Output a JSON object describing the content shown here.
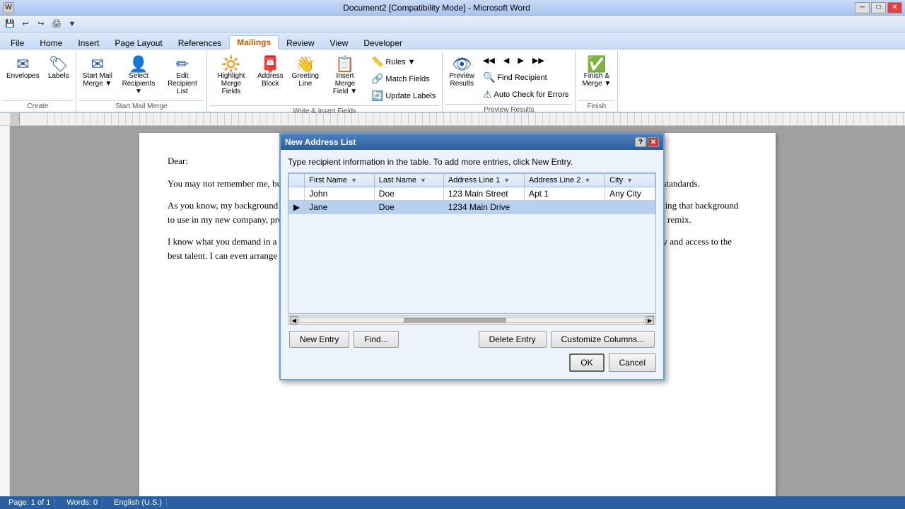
{
  "titlebar": {
    "title": "Document2 [Compatibility Mode] - Microsoft Word",
    "min": "─",
    "restore": "□",
    "close": "✕"
  },
  "quicktoolbar": {
    "buttons": [
      "💾",
      "↩",
      "↪",
      "🖨",
      "⚡"
    ]
  },
  "ribbon": {
    "tabs": [
      "File",
      "Home",
      "Insert",
      "Page Layout",
      "References",
      "Mailings",
      "Review",
      "View",
      "Developer"
    ],
    "active_tab": "Mailings",
    "groups": [
      {
        "label": "Create",
        "buttons": [
          {
            "icon": "✉",
            "label": "Envelopes"
          },
          {
            "icon": "🏷",
            "label": "Labels"
          }
        ]
      },
      {
        "label": "Start Mail Merge",
        "buttons": [
          {
            "icon": "✉",
            "label": "Start Mail Merge ▼"
          },
          {
            "icon": "👤",
            "label": "Select Recipients ▼"
          },
          {
            "icon": "✏",
            "label": "Edit Recipient List"
          }
        ]
      },
      {
        "label": "Write & Insert Fields",
        "buttons": [
          {
            "icon": "🔆",
            "label": "Highlight Merge Fields"
          },
          {
            "icon": "📮",
            "label": "Address Block"
          },
          {
            "icon": "👋",
            "label": "Greeting Line"
          },
          {
            "icon": "📋",
            "label": "Insert Merge Field ▼"
          }
        ],
        "small_buttons": [
          {
            "icon": "📏",
            "label": "Rules ▼"
          },
          {
            "icon": "🔗",
            "label": "Match Fields"
          },
          {
            "icon": "🔄",
            "label": "Update Labels"
          }
        ]
      },
      {
        "label": "Preview Results",
        "buttons": [
          {
            "icon": "👁",
            "label": "Preview Results"
          }
        ],
        "small_buttons": [
          {
            "icon": "◀◀",
            "label": ""
          },
          {
            "icon": "◀",
            "label": ""
          },
          {
            "icon": "▶",
            "label": ""
          },
          {
            "icon": "▶▶",
            "label": ""
          },
          {
            "icon": "🔍",
            "label": "Find Recipient"
          },
          {
            "icon": "⚠",
            "label": "Auto Check for Errors"
          }
        ]
      },
      {
        "label": "Finish",
        "buttons": [
          {
            "icon": "✅",
            "label": "Finish & Merge ▼"
          }
        ]
      }
    ]
  },
  "document": {
    "paragraphs": [
      "Dear:",
      "You may not remember me, but we met at a recording session some years ago, and I became familiar quite quickly with your exacting standards.",
      "As you know, my background spans almost 10 years in the recording business. (We've worked together for almost 10 of them.) I'm putting that background to use in my new company, producing radio spots and live and remote recordings and handling all facets of post-production editing and remix.",
      "I know what you demand in a production, Chris, and I hope you'll continue to let me give it to you. I have a complete new music library and access to the best talent. I can even arrange any duplicating and fulfillment needs you may have. We're located in the new"
    ]
  },
  "dialog": {
    "title": "New Address List",
    "instruction": "Type recipient information in the table.  To add more entries, click New Entry.",
    "columns": [
      "First Name",
      "Last Name",
      "Address Line 1",
      "Address Line 2",
      "City"
    ],
    "rows": [
      {
        "arrow": "",
        "first": "John",
        "last": "Doe",
        "addr1": "123  Main Street",
        "addr2": "Apt 1",
        "city": "Any City"
      },
      {
        "arrow": "▶",
        "first": "Jane",
        "last": "Doe",
        "addr1": "1234 Main Drive",
        "addr2": "",
        "city": "",
        "selected": true
      }
    ],
    "buttons": {
      "new_entry": "New Entry",
      "find": "Find...",
      "delete_entry": "Delete Entry",
      "customize": "Customize Columns...",
      "ok": "OK",
      "cancel": "Cancel"
    }
  },
  "statusbar": {
    "page": "Page: 1 of 1",
    "words": "Words: 0",
    "lang": "English (U.S.)"
  }
}
